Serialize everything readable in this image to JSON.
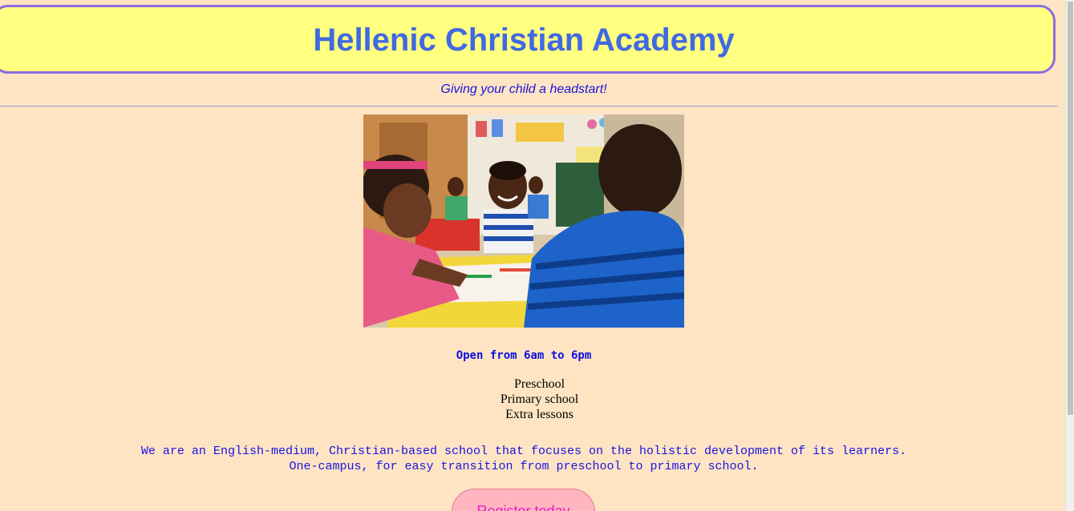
{
  "header": {
    "title": "Hellenic Christian Academy"
  },
  "tagline": "Giving your child a headstart!",
  "photo": {
    "alt": "Children drawing at a classroom table"
  },
  "hours": "Open from 6am to 6pm",
  "programs": [
    "Preschool",
    "Primary school",
    "Extra lessons"
  ],
  "about": {
    "line1": "We are an English-medium, Christian-based school that focuses on the holistic development of its learners.",
    "line2": "One-campus, for easy transition from preschool to primary school."
  },
  "register": {
    "label": "Register today"
  },
  "colors": {
    "background": "#FFE4C4",
    "header_bg": "#FFFF80",
    "header_border": "#8A6DE0",
    "title": "#4169E1",
    "text_blue": "#1A14E0",
    "button_bg": "#FFB6C1",
    "button_text": "#E020C0"
  }
}
